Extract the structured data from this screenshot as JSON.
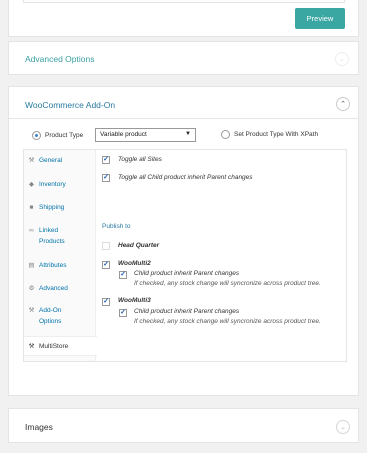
{
  "top_panel": {
    "preview_label": "Preview"
  },
  "advanced": {
    "title": "Advanced Options",
    "toggle_icon": "chevron-down-icon"
  },
  "woo": {
    "title": "WooCommerce Add-On",
    "toggle_icon": "chevron-up-icon",
    "product_type_label": "Product Type",
    "product_type_value": "Variable product",
    "xpath_label": "Set Product Type With XPath",
    "tabs": [
      {
        "label": "General",
        "icon": "wrench-icon"
      },
      {
        "label": "Inventory",
        "icon": "tag-icon"
      },
      {
        "label": "Shipping",
        "icon": "truck-icon"
      },
      {
        "label": "Linked Products",
        "icon": "link-icon"
      },
      {
        "label": "Attributes",
        "icon": "list-icon"
      },
      {
        "label": "Advanced",
        "icon": "gear-icon"
      },
      {
        "label": "Add-On Options",
        "icon": "wrench-icon"
      },
      {
        "label": "MultiStore",
        "icon": "wrench-icon"
      }
    ],
    "toggle_all_sites": "Toggle all Sites",
    "toggle_all_child": "Toggle all Child product inherit Parent changes",
    "publish_to": "Publish to",
    "sites": [
      {
        "name": "Head Quarter",
        "checked": false
      },
      {
        "name": "WooMulti2",
        "checked": true,
        "child_label": "Child product inherit Parent changes",
        "child_desc": "If checked, any stock change will syncronize across product tree."
      },
      {
        "name": "WooMulti3",
        "checked": true,
        "child_label": "Child product inherit Parent changes",
        "child_desc": "If checked, any stock change will syncronize across product tree."
      }
    ]
  },
  "images": {
    "title": "Images",
    "toggle_icon": "chevron-down-icon"
  }
}
